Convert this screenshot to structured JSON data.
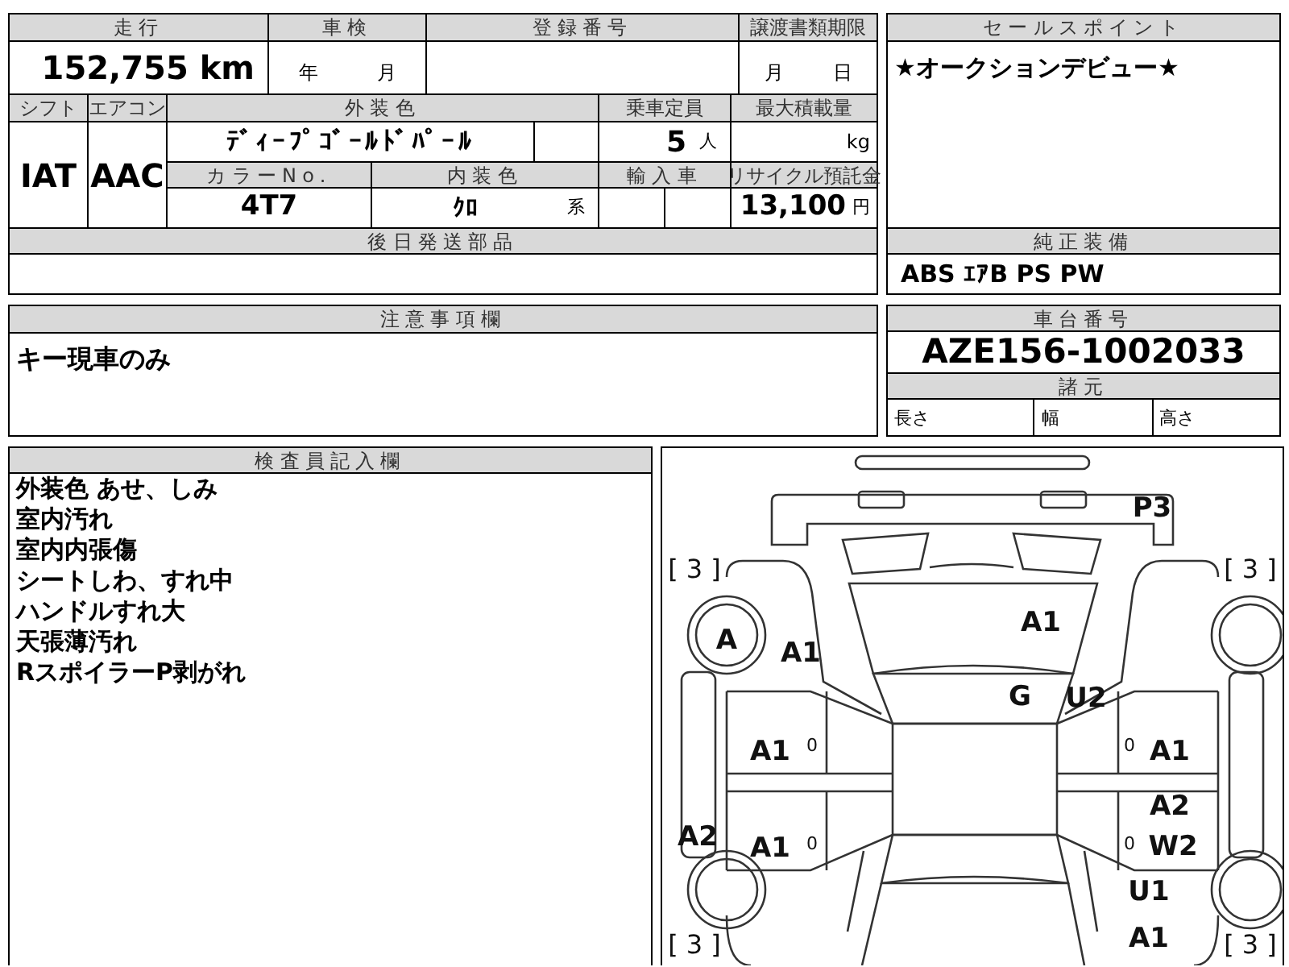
{
  "mileage": {
    "label": "走行",
    "value": "152,755",
    "unit": "km"
  },
  "inspection": {
    "label": "車検",
    "year_unit": "年",
    "month_unit": "月"
  },
  "registration": {
    "label": "登録番号"
  },
  "transfer_deadline": {
    "label": "譲渡書類期限",
    "month_unit": "月",
    "day_unit": "日"
  },
  "shift": {
    "label": "シフト",
    "value": "IAT"
  },
  "aircon": {
    "label": "エアコン",
    "value": "AAC"
  },
  "exterior_color": {
    "label": "外装色",
    "value": "ﾃﾞｨｰﾌﾟｺﾞｰﾙﾄﾞﾊﾟｰﾙ"
  },
  "capacity": {
    "label": "乗車定員",
    "value": "5",
    "unit": "人"
  },
  "max_load": {
    "label": "最大積載量",
    "unit": "kg"
  },
  "color_no": {
    "label": "カラーNo.",
    "value": "4T7"
  },
  "interior_color": {
    "label": "内装色",
    "value": "ｸﾛ",
    "suffix": "系"
  },
  "import_car": {
    "label": "輸入車"
  },
  "recycle_fee": {
    "label": "リサイクル預託金",
    "value": "13,100",
    "unit": "円"
  },
  "later_parts": {
    "label": "後日発送部品"
  },
  "sales_point": {
    "label": "セールスポイント",
    "text": "★オークションデビュー★"
  },
  "equipment": {
    "label": "純正装備",
    "value": "ABS ｴｱB PS PW"
  },
  "notes": {
    "label": "注意事項欄",
    "text": "キー現車のみ"
  },
  "chassis": {
    "label": "車台番号",
    "value": "AZE156-1002033"
  },
  "specs": {
    "label": "諸元",
    "fields": [
      "長さ",
      "幅",
      "高さ"
    ]
  },
  "inspector_notes": {
    "label": "検査員記入欄",
    "lines": [
      "外装色 あせ、しみ",
      "室内汚れ",
      "室内内張傷",
      "シートしわ、すれ中",
      "ハンドルすれ大",
      "天張薄汚れ",
      "RスポイラーP剥がれ"
    ]
  },
  "diagram": {
    "marks": [
      {
        "kind": "damage",
        "text": "P3"
      },
      {
        "kind": "tread",
        "text": "[ 3 ]"
      },
      {
        "kind": "tread",
        "text": "[ 3 ]"
      },
      {
        "kind": "damage",
        "text": "A"
      },
      {
        "kind": "damage",
        "text": "A1"
      },
      {
        "kind": "damage",
        "text": "A1"
      },
      {
        "kind": "damage",
        "text": "G"
      },
      {
        "kind": "damage",
        "text": "U2"
      },
      {
        "kind": "damage",
        "text": "A1"
      },
      {
        "kind": "small",
        "text": "0"
      },
      {
        "kind": "small",
        "text": "0"
      },
      {
        "kind": "damage",
        "text": "A1"
      },
      {
        "kind": "damage",
        "text": "A2"
      },
      {
        "kind": "damage",
        "text": "A2"
      },
      {
        "kind": "damage",
        "text": "A1"
      },
      {
        "kind": "small",
        "text": "0"
      },
      {
        "kind": "small",
        "text": "0"
      },
      {
        "kind": "damage",
        "text": "W2"
      },
      {
        "kind": "damage",
        "text": "U1"
      },
      {
        "kind": "tread",
        "text": "[ 3 ]"
      },
      {
        "kind": "damage",
        "text": "A1"
      },
      {
        "kind": "tread",
        "text": "[ 3 ]"
      }
    ]
  }
}
